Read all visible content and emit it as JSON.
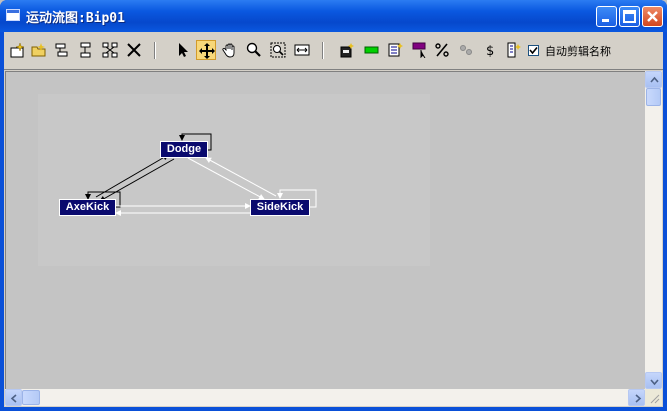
{
  "window": {
    "title": "运动流图:Bip01",
    "buttons": [
      "minimize",
      "maximize",
      "close"
    ]
  },
  "toolbar": {
    "tools": [
      {
        "name": "create-clip-icon"
      },
      {
        "name": "open-file-icon"
      },
      {
        "name": "insert-clip-icon"
      },
      {
        "name": "insert-transition-icon"
      },
      {
        "name": "select-connected-icon"
      },
      {
        "name": "delete-icon"
      },
      {
        "name": "select-arrow-icon"
      },
      {
        "name": "move-icon",
        "active": true
      },
      {
        "name": "pan-hand-icon"
      },
      {
        "name": "zoom-icon"
      },
      {
        "name": "zoom-region-icon"
      },
      {
        "name": "zoom-extents-icon"
      },
      {
        "name": "clip-properties-icon"
      },
      {
        "name": "green-clip-icon"
      },
      {
        "name": "list-icon"
      },
      {
        "name": "purple-transition-icon"
      },
      {
        "name": "percent-icon"
      },
      {
        "name": "random-icon"
      },
      {
        "name": "dollar-icon"
      },
      {
        "name": "script-icon"
      }
    ],
    "auto_clip_name": {
      "label": "自动剪辑名称",
      "checked": true
    }
  },
  "graph": {
    "nodes": [
      {
        "id": "dodge",
        "label": "Dodge"
      },
      {
        "id": "axekick",
        "label": "AxeKick"
      },
      {
        "id": "sidekick",
        "label": "SideKick"
      }
    ]
  },
  "colors": {
    "titlebar": "#0a58e0",
    "node_fill": "#0a0a6e",
    "canvas": "#c4c4c4",
    "active_tool": "#f7d77a"
  }
}
